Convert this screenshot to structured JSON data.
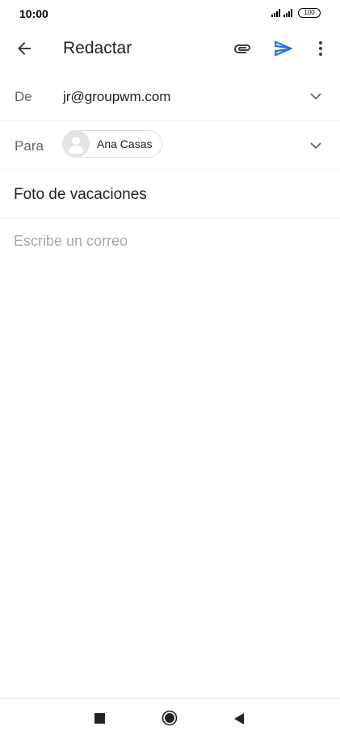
{
  "status_bar": {
    "time": "10:00",
    "battery": "100"
  },
  "app_bar": {
    "title": "Redactar",
    "icons": [
      "arrow-back-icon",
      "paperclip-icon",
      "send-icon",
      "more-vert-icon"
    ],
    "send_color": "#1a73e8"
  },
  "compose": {
    "from": {
      "label": "De",
      "value": "jr@groupwm.com"
    },
    "to": {
      "label": "Para",
      "recipient": "Ana Casas"
    },
    "subject": "Foto de vacaciones",
    "body_placeholder": "Escribe un correo"
  },
  "navigation": {
    "icons": [
      "recents-icon",
      "home-icon",
      "back-icon"
    ]
  }
}
